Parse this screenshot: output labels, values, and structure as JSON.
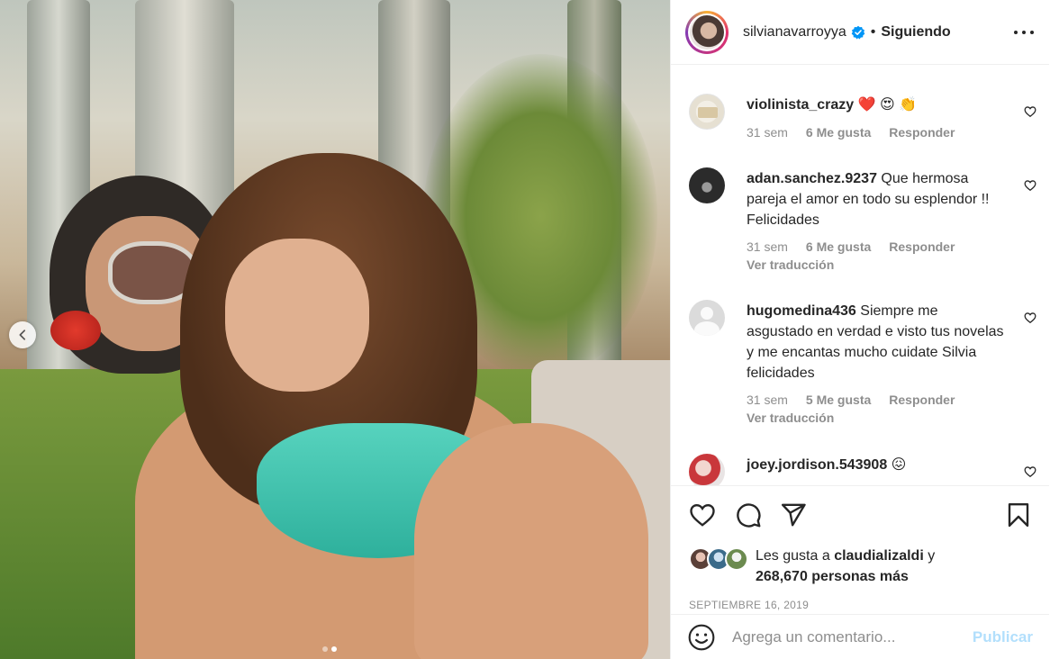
{
  "post": {
    "username": "silvianavarroyya",
    "separator": "•",
    "follow_status": "Siguiendo",
    "carousel": {
      "total": 2,
      "current": 2
    }
  },
  "comments": [
    {
      "user": "violinista_crazy",
      "text": "❤️ 😍 👏",
      "time": "31 sem",
      "likes": "6 Me gusta",
      "reply": "Responder",
      "translate": ""
    },
    {
      "user": "adan.sanchez.9237",
      "text": "Que hermosa pareja el amor en todo su esplendor !! Felicidades",
      "time": "31 sem",
      "likes": "6 Me gusta",
      "reply": "Responder",
      "translate": "Ver traducción"
    },
    {
      "user": "hugomedina436",
      "text": "Siempre me asgustado en verdad e visto tus novelas y me encantas mucho cuidate Silvia felicidades",
      "time": "31 sem",
      "likes": "5 Me gusta",
      "reply": "Responder",
      "translate": "Ver traducción"
    },
    {
      "user": "joey.jordison.543908",
      "text": "😖",
      "time": "",
      "likes": "",
      "reply": "",
      "translate": ""
    }
  ],
  "likes": {
    "prefix": "Les gusta a",
    "user": "claudializaldi",
    "conjunction": "y",
    "others": "268,670 personas más"
  },
  "date": "SEPTIEMBRE 16, 2019",
  "add_comment": {
    "placeholder": "Agrega un comentario...",
    "publish_label": "Publicar"
  },
  "colors": {
    "verified": "#0095f6",
    "publish_disabled": "#b2dffc",
    "muted_text": "#8e8e8e"
  },
  "icons": [
    "chevron-left-icon",
    "verified-badge-icon",
    "more-options-icon",
    "heart-icon",
    "comment-icon",
    "share-icon",
    "bookmark-icon",
    "emoji-icon"
  ]
}
